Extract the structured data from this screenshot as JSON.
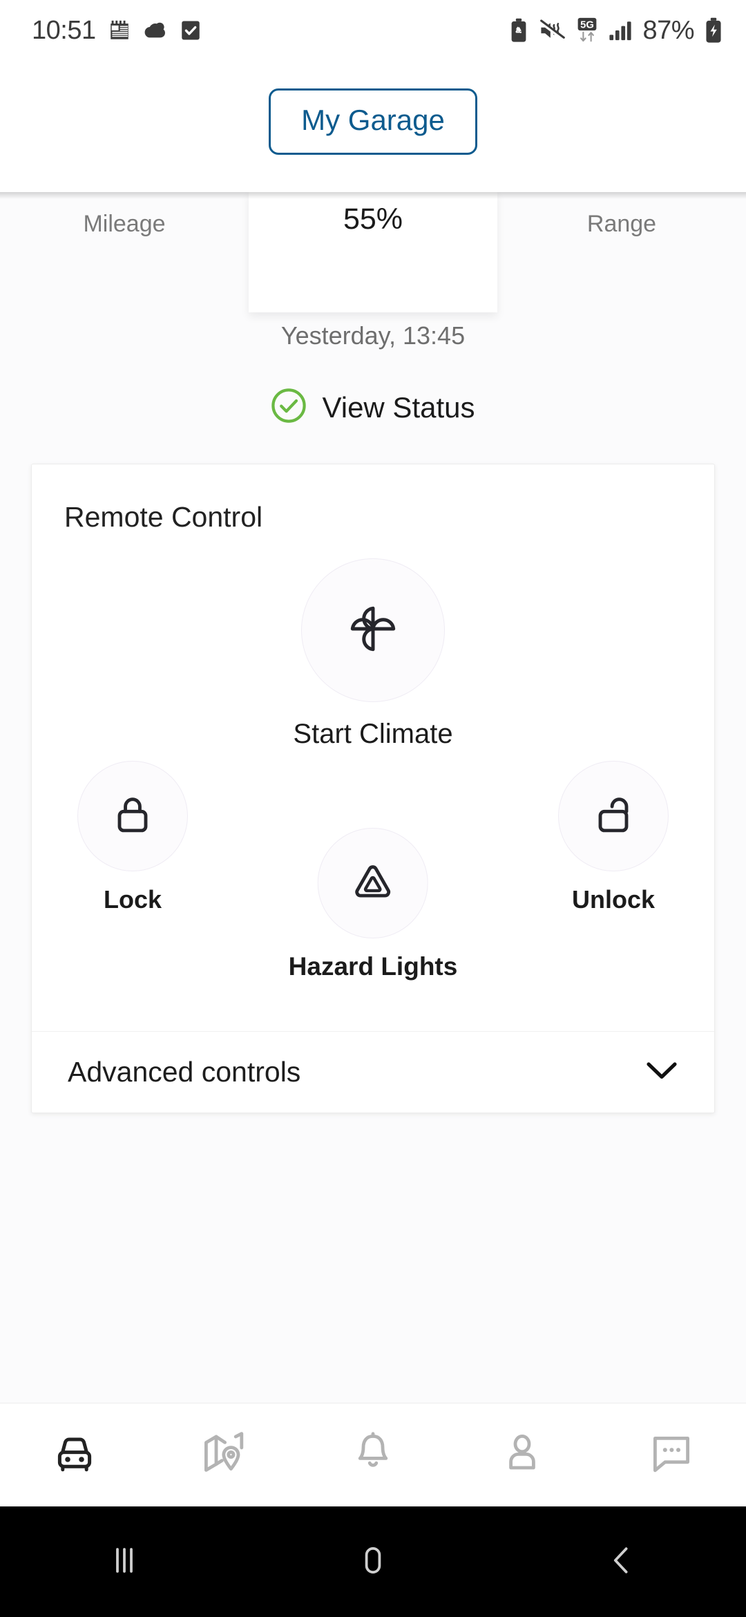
{
  "status_bar": {
    "time": "10:51",
    "battery_percent": "87%",
    "left_icons": [
      "calendar-icon",
      "weather-cloud-icon",
      "tasks-check-icon"
    ],
    "right_icons": [
      "battery-saver-icon",
      "mute-vibrate-icon",
      "network-5g-icon",
      "signal-bars-icon",
      "battery-charging-icon"
    ]
  },
  "header": {
    "garage_button": "My Garage"
  },
  "tabs": [
    {
      "label": "Mileage",
      "active": false
    },
    {
      "label": "55%",
      "active": true
    },
    {
      "label": "Range",
      "active": false
    }
  ],
  "vehicle": {
    "timestamp": "Yesterday, 13:45",
    "view_status_label": "View Status",
    "status_icon_color": "#6ab943"
  },
  "remote_control": {
    "title": "Remote Control",
    "primary": {
      "label": "Start Climate",
      "icon": "fan-pinwheel-icon"
    },
    "controls": [
      {
        "label": "Lock",
        "icon": "padlock-closed-icon"
      },
      {
        "label": "Hazard Lights",
        "icon": "hazard-triangle-icon"
      },
      {
        "label": "Unlock",
        "icon": "padlock-open-icon"
      }
    ],
    "advanced": {
      "label": "Advanced controls",
      "icon": "chevron-down-icon"
    }
  },
  "bottom_nav": [
    {
      "name": "vehicle",
      "icon": "car-icon",
      "active": true
    },
    {
      "name": "map",
      "icon": "map-pin-icon",
      "active": false
    },
    {
      "name": "notifications",
      "icon": "bell-icon",
      "active": false
    },
    {
      "name": "profile",
      "icon": "person-icon",
      "active": false
    },
    {
      "name": "messages",
      "icon": "chat-bubble-icon",
      "active": false
    }
  ],
  "android_nav": [
    {
      "name": "recents",
      "icon": "recents-icon"
    },
    {
      "name": "home",
      "icon": "home-icon"
    },
    {
      "name": "back",
      "icon": "back-icon"
    }
  ],
  "colors": {
    "brand_blue": "#0d5b8e",
    "status_green": "#6ab943",
    "active_nav": "#222222",
    "inactive_nav": "#b3b3b3"
  }
}
